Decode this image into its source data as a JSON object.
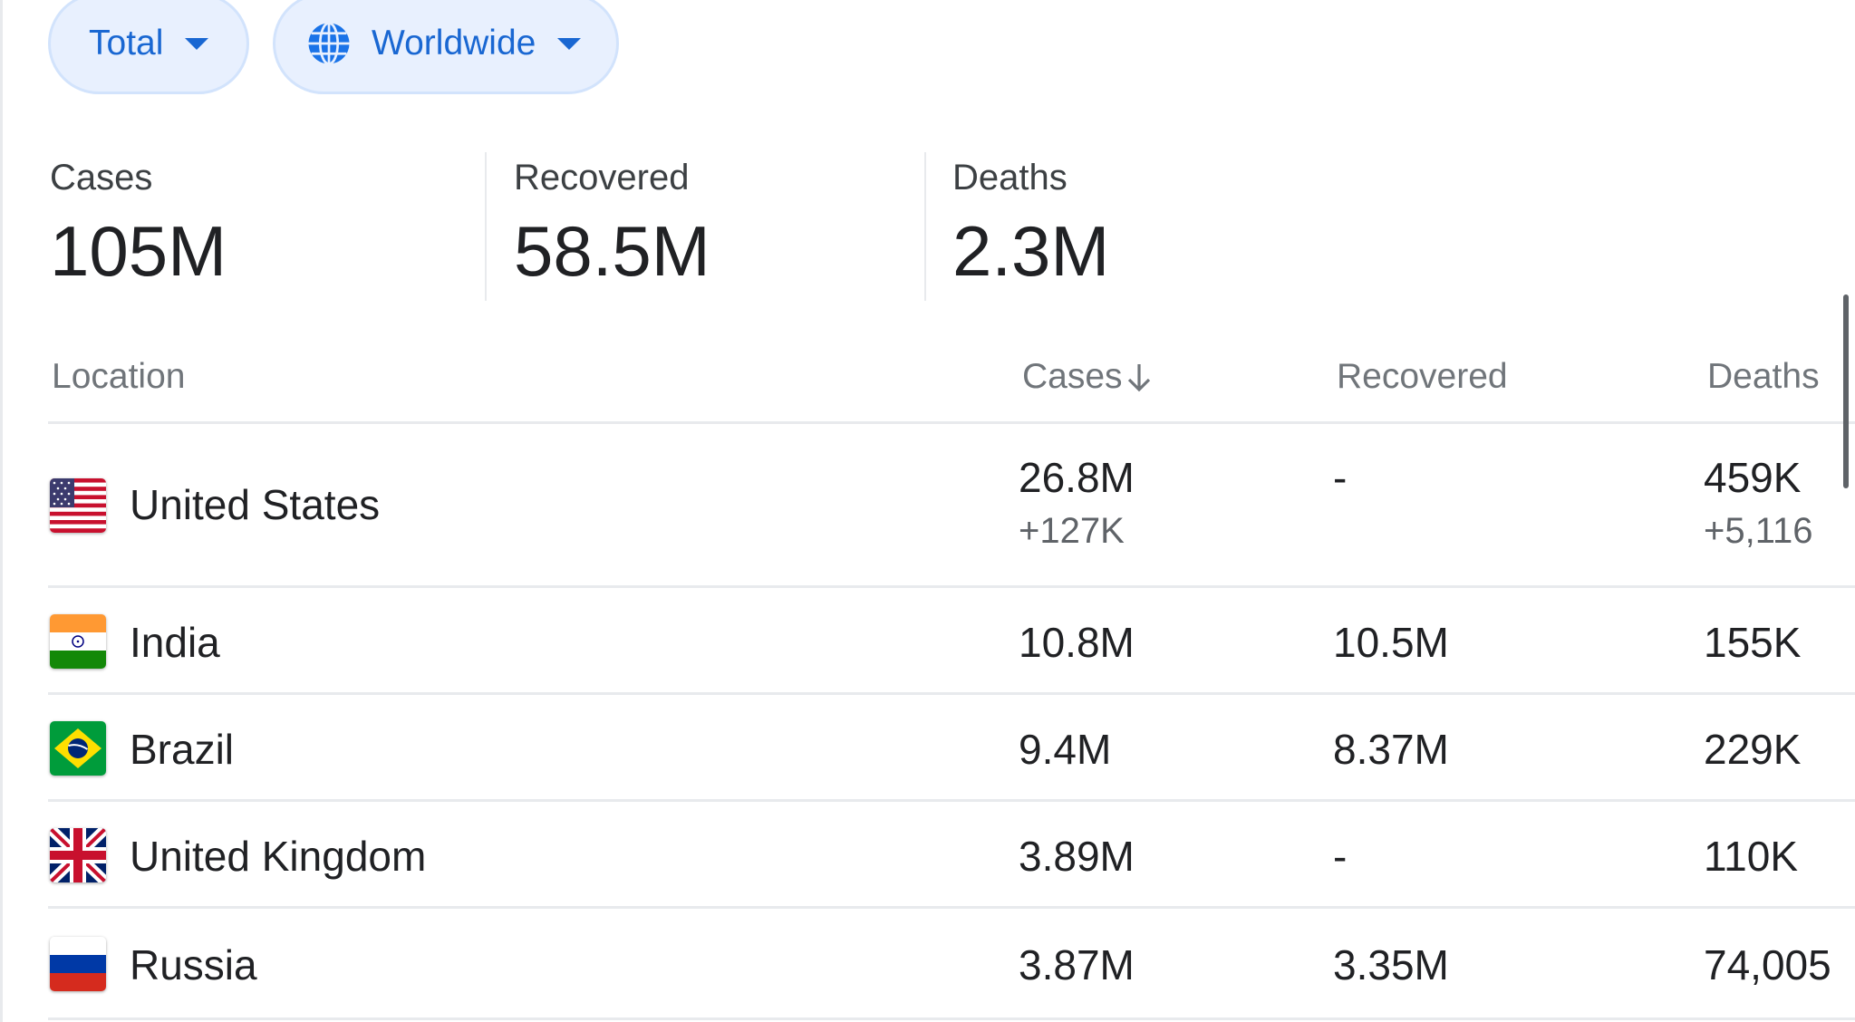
{
  "filters": {
    "period": "Total",
    "region": "Worldwide"
  },
  "summary": {
    "cases": {
      "label": "Cases",
      "value": "105M"
    },
    "recovered": {
      "label": "Recovered",
      "value": "58.5M"
    },
    "deaths": {
      "label": "Deaths",
      "value": "2.3M"
    }
  },
  "table": {
    "headers": {
      "location": "Location",
      "cases": "Cases",
      "recovered": "Recovered",
      "deaths": "Deaths"
    },
    "sort": {
      "column": "cases",
      "direction": "descending",
      "icon": "arrow-down-icon"
    },
    "rows": [
      {
        "flag": "us-flag-icon",
        "location": "United States",
        "cases": "26.8M",
        "cases_delta": "+127K",
        "recovered": "-",
        "deaths": "459K",
        "deaths_delta": "+5,116"
      },
      {
        "flag": "india-flag-icon",
        "location": "India",
        "cases": "10.8M",
        "recovered": "10.5M",
        "deaths": "155K"
      },
      {
        "flag": "brazil-flag-icon",
        "location": "Brazil",
        "cases": "9.4M",
        "recovered": "8.37M",
        "deaths": "229K"
      },
      {
        "flag": "uk-flag-icon",
        "location": "United Kingdom",
        "cases": "3.89M",
        "recovered": "-",
        "deaths": "110K"
      },
      {
        "flag": "russia-flag-icon",
        "location": "Russia",
        "cases": "3.87M",
        "recovered": "3.35M",
        "deaths": "74,005"
      }
    ]
  },
  "colors": {
    "chip_background": "#e8f0fe",
    "chip_border": "#d2e3fc",
    "chip_text": "#1967d2",
    "divider": "#e8eaed",
    "header_text": "#70757a"
  }
}
